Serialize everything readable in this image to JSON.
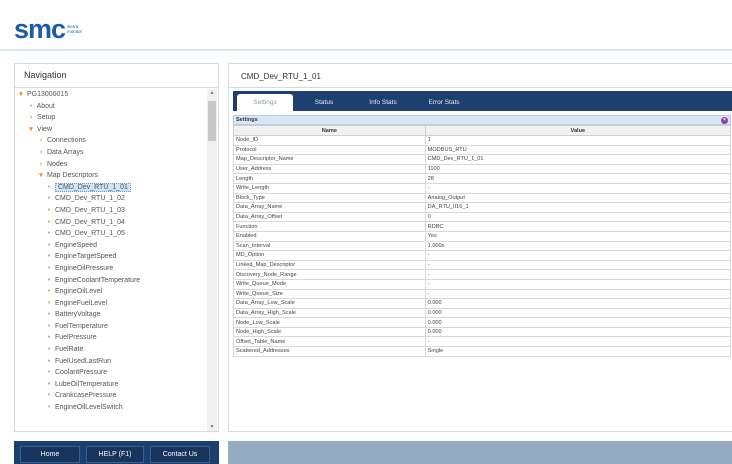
{
  "brand": {
    "logo": "smc",
    "tagline": "sierra monitor"
  },
  "nav": {
    "title": "Navigation",
    "items": [
      {
        "label": "PG13000015",
        "marker": "▾",
        "level": 0
      },
      {
        "label": "About",
        "marker": "•",
        "level": 1
      },
      {
        "label": "Setup",
        "marker": "›",
        "level": 1
      },
      {
        "label": "View",
        "marker": "▾",
        "level": 1
      },
      {
        "label": "Connections",
        "marker": "›",
        "level": 2
      },
      {
        "label": "Data Arrays",
        "marker": "›",
        "level": 2
      },
      {
        "label": "Nodes",
        "marker": "›",
        "level": 2
      },
      {
        "label": "Map Descriptors",
        "marker": "▾",
        "level": 2
      },
      {
        "label": "CMD_Dev_RTU_1_01",
        "marker": "•",
        "level": 3,
        "selected": true
      },
      {
        "label": "CMD_Dev_RTU_1_02",
        "marker": "•",
        "level": 3
      },
      {
        "label": "CMD_Dev_RTU_1_03",
        "marker": "•",
        "level": 3
      },
      {
        "label": "CMD_Dev_RTU_1_04",
        "marker": "•",
        "level": 3
      },
      {
        "label": "CMD_Dev_RTU_1_05",
        "marker": "•",
        "level": 3
      },
      {
        "label": "EngineSpeed",
        "marker": "•",
        "level": 3
      },
      {
        "label": "EngineTargetSpeed",
        "marker": "•",
        "level": 3
      },
      {
        "label": "EngineOilPressure",
        "marker": "•",
        "level": 3
      },
      {
        "label": "EngineCoolantTemperature",
        "marker": "•",
        "level": 3
      },
      {
        "label": "EngineOilLevel",
        "marker": "•",
        "level": 3
      },
      {
        "label": "EngineFuelLevel",
        "marker": "•",
        "level": 3
      },
      {
        "label": "BatteryVoltage",
        "marker": "•",
        "level": 3
      },
      {
        "label": "FuelTemperature",
        "marker": "•",
        "level": 3
      },
      {
        "label": "FuelPressure",
        "marker": "•",
        "level": 3
      },
      {
        "label": "FuelRate",
        "marker": "•",
        "level": 3
      },
      {
        "label": "FuelUsedLastRun",
        "marker": "•",
        "level": 3
      },
      {
        "label": "CoolantPressure",
        "marker": "•",
        "level": 3
      },
      {
        "label": "LubeOilTemperature",
        "marker": "•",
        "level": 3
      },
      {
        "label": "CrankcasePressure",
        "marker": "•",
        "level": 3
      },
      {
        "label": "EngineOilLevelSwitch",
        "marker": "•",
        "level": 3
      }
    ]
  },
  "main": {
    "title": "CMD_Dev_RTU_1_01",
    "tabs": [
      "Settings",
      "Status",
      "Info Stats",
      "Error Stats"
    ],
    "active_tab": "Settings",
    "section_label": "Settings",
    "columns": [
      "Name",
      "Value"
    ],
    "rows": [
      [
        "Node_ID",
        "1"
      ],
      [
        "Protocol",
        "MODBUS_RTU"
      ],
      [
        "Map_Descriptor_Name",
        "CMD_Dev_RTU_1_01"
      ],
      [
        "User_Address",
        "1100"
      ],
      [
        "Length",
        "28"
      ],
      [
        "Write_Length",
        "-"
      ],
      [
        "Block_Type",
        "Analog_Output"
      ],
      [
        "Data_Array_Name",
        "DA_RTU_II16_1"
      ],
      [
        "Data_Array_Offset",
        "0"
      ],
      [
        "Function",
        "RDBC"
      ],
      [
        "Enabled",
        "Yes"
      ],
      [
        "Scan_Interval",
        "1.000s"
      ],
      [
        "MD_Option",
        "-"
      ],
      [
        "Linked_Map_Descriptor",
        "-"
      ],
      [
        "Discovery_Node_Range",
        "-"
      ],
      [
        "Write_Queue_Mode",
        "-"
      ],
      [
        "Write_Queue_Size",
        "-"
      ],
      [
        "Data_Array_Low_Scale",
        "0.000"
      ],
      [
        "Data_Array_High_Scale",
        "0.000"
      ],
      [
        "Node_Low_Scale",
        "0.000"
      ],
      [
        "Node_High_Scale",
        "0.000"
      ],
      [
        "Offset_Table_Name",
        "-"
      ],
      [
        "Scattered_Addresses",
        "Single"
      ]
    ]
  },
  "footer": {
    "buttons": [
      "Home",
      "HELP (F1)",
      "Contact Us"
    ]
  },
  "colors": {
    "brand": "#1e5aa8",
    "nav_bar": "#1d3f6f",
    "footer_strip": "#95abc1",
    "accent": "#e8922c"
  }
}
